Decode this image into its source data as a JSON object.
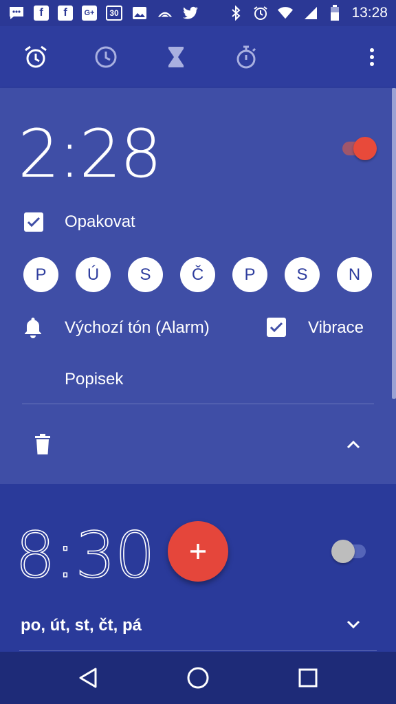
{
  "status_bar": {
    "time": "13:28",
    "app_icons": [
      "chat-icon",
      "facebook-icon",
      "facebook-icon",
      "google-plus-icon",
      "calendar-icon",
      "image-icon",
      "cloud-icon",
      "twitter-icon"
    ],
    "gplus_label": "G+",
    "facebook_label": "f",
    "calendar_label": "30",
    "system_icons": [
      "bluetooth-icon",
      "alarm-icon",
      "wifi-icon",
      "signal-icon",
      "battery-icon"
    ]
  },
  "tabs": [
    {
      "name": "alarm",
      "icon": "alarm-clock-icon",
      "active": true
    },
    {
      "name": "clock",
      "icon": "clock-icon",
      "active": false
    },
    {
      "name": "timer",
      "icon": "hourglass-icon",
      "active": false
    },
    {
      "name": "stopwatch",
      "icon": "stopwatch-icon",
      "active": false
    }
  ],
  "alarm1": {
    "time": "2:28",
    "enabled": true,
    "repeat_label": "Opakovat",
    "repeat_checked": true,
    "days": [
      "P",
      "Ú",
      "S",
      "Č",
      "P",
      "S",
      "N"
    ],
    "ringtone_label": "Výchozí tón (Alarm)",
    "vibrate_label": "Vibrace",
    "vibrate_checked": true,
    "label_text": "Popisek"
  },
  "alarm2": {
    "time": "8:30",
    "enabled": false,
    "days_summary": "po, út, st, čt, pá"
  },
  "colors": {
    "primary": "#2e3d9e",
    "card": "#3f4ea6",
    "accent": "#e5463b"
  }
}
